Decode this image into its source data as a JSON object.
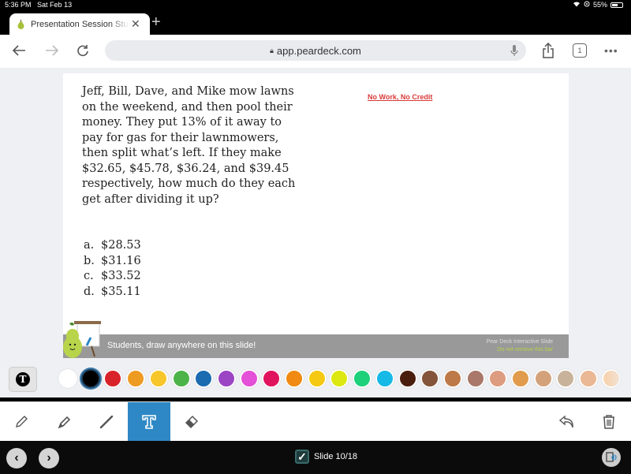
{
  "status_bar": {
    "time": "5:36 PM",
    "date": "Sat Feb 13",
    "battery": "55%",
    "battery_level": 0.55
  },
  "browser": {
    "tab_title": "Presentation Session Student",
    "new_tab": "+",
    "close": "✕",
    "url": "app.peardeck.com",
    "tab_count": "1",
    "more": "•••"
  },
  "slide": {
    "question": "Jeff, Bill, Dave, and Mike mow lawns on the weekend, and then pool their money.  They put 13% of it away to pay for gas for their lawnmowers, then split what’s left.  If they make $32.65, $45.78, $36.24, and $39.45 respectively, how much do they each get after dividing it up?",
    "answers": [
      {
        "letter": "a.",
        "value": "$28.53"
      },
      {
        "letter": "b.",
        "value": "$31.16"
      },
      {
        "letter": "c.",
        "value": "$33.52"
      },
      {
        "letter": "d.",
        "value": "$35.11"
      }
    ],
    "note": "No Work, No Credit",
    "draw_bar_text": "Students, draw anywhere on this slide!",
    "brand_line1": "Pear Deck Interactive Slide",
    "brand_line2": "Do not remove this bar"
  },
  "palette": {
    "text_tool_label": "T",
    "selected_index": 1,
    "colors": [
      "#ffffff",
      "#000000",
      "#d9232a",
      "#ee9b22",
      "#f7c62b",
      "#4cb348",
      "#1a6bb0",
      "#9b45c4",
      "#e450d8",
      "#e0135f",
      "#f08a12",
      "#f5c911",
      "#dde813",
      "#1dd07a",
      "#17b9e6",
      "#4a1e0f",
      "#84553a",
      "#bd7a48",
      "#a9786a",
      "#dd9c80",
      "#e09c4c",
      "#d4a27a",
      "#c8b29a",
      "#eab894",
      "#f6d4b2"
    ]
  },
  "tools": {
    "items": [
      "pencil",
      "highlighter",
      "line",
      "text",
      "eraser"
    ],
    "active": "text",
    "text_label": "T"
  },
  "footer": {
    "prev": "‹",
    "next": "›",
    "slide_label": "Slide 10/18"
  }
}
